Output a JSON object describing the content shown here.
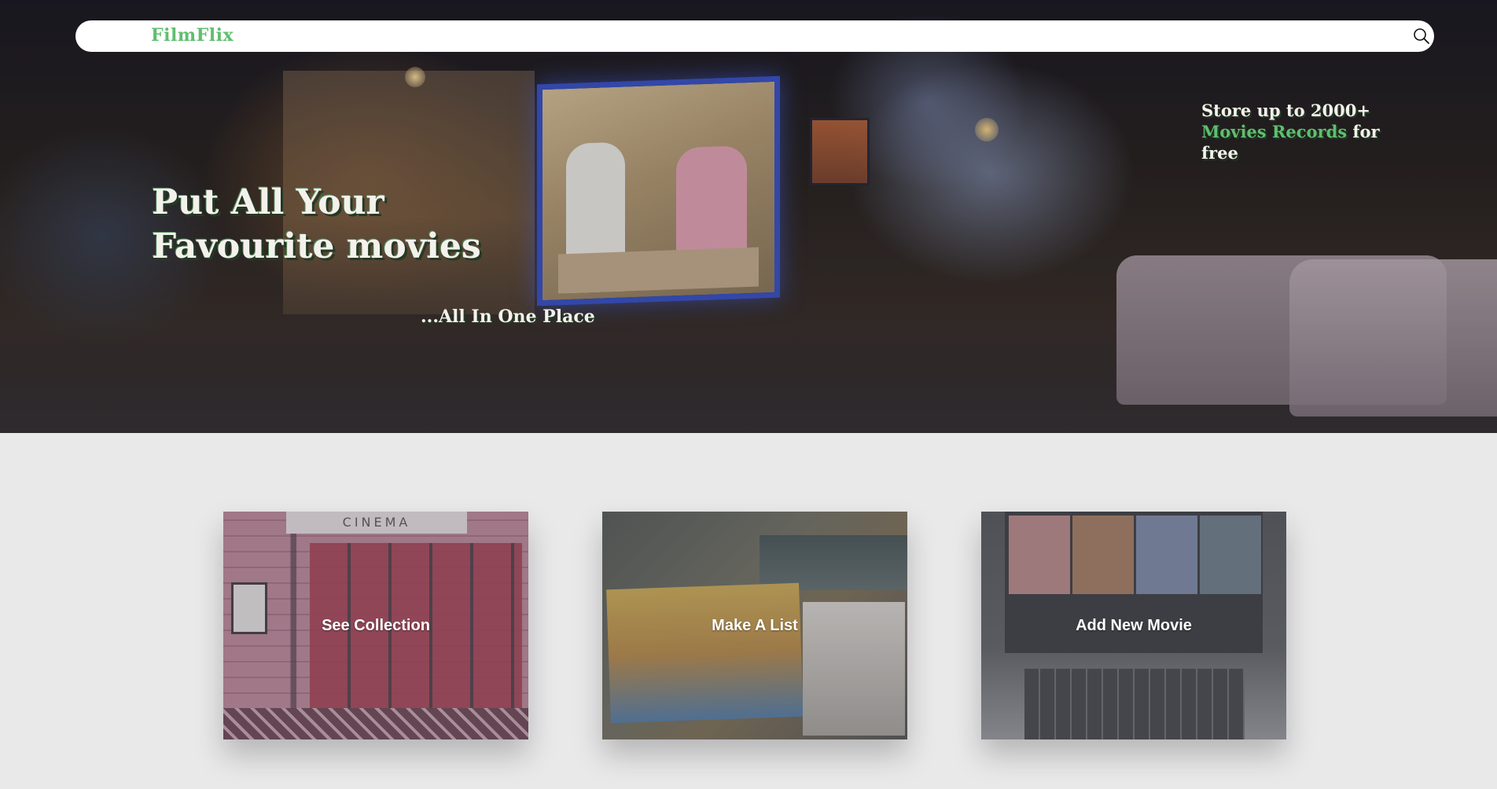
{
  "nav": {
    "brand": "FilmFlix",
    "search_icon": "search-icon"
  },
  "hero": {
    "headline": "Put All Your Favourite movies",
    "tagline": "...All In One Place",
    "promo": {
      "part1": "Store up to 2000+ ",
      "highlight1": "Movies Records",
      "part2": " for free"
    }
  },
  "cards": [
    {
      "label": "See Collection",
      "image_text": "CINEMA"
    },
    {
      "label": "Make A List"
    },
    {
      "label": "Add New Movie"
    }
  ],
  "colors": {
    "accent": "#5fbf6e",
    "page_bg": "#e9e9ea"
  }
}
